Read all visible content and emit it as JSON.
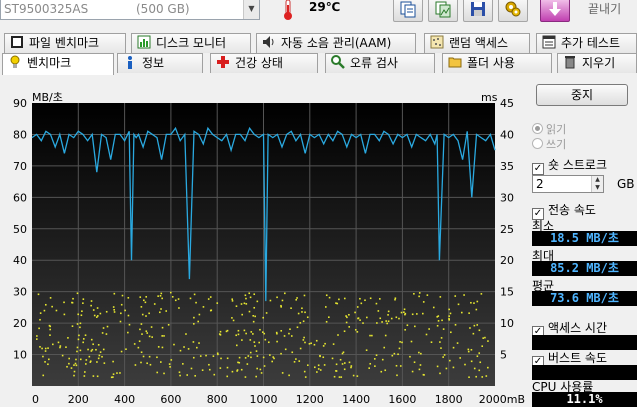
{
  "toolbar": {
    "drive_name": "ST9500325AS",
    "drive_capacity": "(500 GB)",
    "temperature": "29℃",
    "exit_label": "끝내기",
    "buttons": [
      "copy-text-icon",
      "copy-image-icon",
      "save-icon",
      "options-icon",
      "download-icon"
    ]
  },
  "tabs_row1": [
    {
      "label": "파일 벤치마크",
      "icon": "file-benchmark-icon"
    },
    {
      "label": "디스크 모니터",
      "icon": "disk-monitor-icon"
    },
    {
      "label": "자동 소음 관리(AAM)",
      "icon": "speaker-icon"
    },
    {
      "label": "랜덤 액세스",
      "icon": "random-access-icon"
    },
    {
      "label": "추가 테스트",
      "icon": "extra-tests-icon"
    }
  ],
  "tabs_row2": [
    {
      "label": "벤치마크",
      "icon": "benchmark-icon",
      "active": true
    },
    {
      "label": "정보",
      "icon": "info-icon",
      "active": false
    },
    {
      "label": "건강 상태",
      "icon": "health-icon",
      "active": false
    },
    {
      "label": "오류 검사",
      "icon": "error-scan-icon",
      "active": false
    },
    {
      "label": "폴더 사용",
      "icon": "folder-usage-icon",
      "active": false
    },
    {
      "label": "지우기",
      "icon": "erase-icon",
      "active": false
    }
  ],
  "panel": {
    "stop_label": "중지",
    "read_label": "읽기",
    "write_label": "쓰기",
    "short_stroke_label": "숏 스트로크",
    "short_stroke_value": "2",
    "short_stroke_unit": "GB",
    "transfer_rate_label": "전송 속도",
    "min_label": "최소",
    "min_value": "18.5 MB/초",
    "max_label": "최대",
    "max_value": "85.2 MB/초",
    "avg_label": "평균",
    "avg_value": "73.6 MB/초",
    "access_time_label": "액세스 시간",
    "access_time_value": "",
    "burst_rate_label": "버스트 속도",
    "burst_rate_value": "",
    "cpu_label": "CPU 사용률",
    "cpu_value": "11.1%"
  },
  "colors": {
    "line": "#2aa9e0",
    "dots": "#e8e830",
    "grid": "#555555",
    "plot_bg_top": "#000000",
    "plot_bg_bottom": "#3c3c3c"
  },
  "chart_data": {
    "type": "line",
    "y_left_label": "MB/초",
    "y_right_label": "ms",
    "x_unit": "mB",
    "x_range": [
      0,
      2000
    ],
    "y_left_range": [
      0,
      90
    ],
    "y_right_range": [
      0,
      45
    ],
    "x_ticks": [
      "0",
      "200",
      "400",
      "600",
      "800",
      "1000",
      "1200",
      "1400",
      "1600",
      "1800",
      "2000mB"
    ],
    "y_left_ticks": [
      "10",
      "20",
      "30",
      "40",
      "50",
      "60",
      "70",
      "80",
      "90"
    ],
    "y_right_ticks": [
      "5",
      "10",
      "15",
      "20",
      "25",
      "30",
      "35",
      "40",
      "45"
    ],
    "grid": true,
    "series": [
      {
        "name": "전송 속도",
        "x": [
          0,
          20,
          40,
          60,
          80,
          100,
          120,
          140,
          160,
          180,
          200,
          220,
          240,
          260,
          280,
          300,
          320,
          340,
          360,
          380,
          400,
          420,
          430,
          440,
          450,
          460,
          480,
          500,
          520,
          540,
          560,
          580,
          600,
          620,
          640,
          660,
          680,
          700,
          720,
          740,
          760,
          780,
          800,
          820,
          840,
          860,
          880,
          900,
          920,
          940,
          960,
          980,
          1000,
          1010,
          1020,
          1040,
          1060,
          1080,
          1100,
          1120,
          1140,
          1160,
          1180,
          1200,
          1220,
          1240,
          1260,
          1280,
          1300,
          1320,
          1340,
          1360,
          1380,
          1400,
          1420,
          1440,
          1460,
          1480,
          1500,
          1520,
          1540,
          1560,
          1580,
          1600,
          1620,
          1640,
          1660,
          1680,
          1700,
          1720,
          1740,
          1750,
          1760,
          1780,
          1800,
          1820,
          1840,
          1860,
          1880,
          1900,
          1920,
          1940,
          1960,
          1980,
          2000
        ],
        "values": [
          79,
          80,
          78,
          81,
          80,
          76,
          80,
          74,
          80,
          79,
          81,
          80,
          78,
          80,
          68,
          80,
          79,
          72,
          80,
          80,
          78,
          81,
          40,
          80,
          79,
          80,
          76,
          81,
          80,
          79,
          72,
          80,
          80,
          82,
          78,
          80,
          34,
          81,
          80,
          77,
          82,
          80,
          79,
          78,
          80,
          75,
          80,
          80,
          78,
          82,
          80,
          79,
          80,
          27,
          80,
          79,
          80,
          76,
          80,
          81,
          78,
          80,
          74,
          80,
          79,
          80,
          77,
          80,
          78,
          81,
          80,
          76,
          80,
          79,
          80,
          74,
          80,
          80,
          78,
          81,
          80,
          77,
          80,
          79,
          80,
          76,
          80,
          79,
          78,
          80,
          77,
          80,
          40,
          80,
          79,
          80,
          78,
          72,
          81,
          60,
          80,
          79,
          78,
          80,
          75
        ]
      }
    ]
  }
}
